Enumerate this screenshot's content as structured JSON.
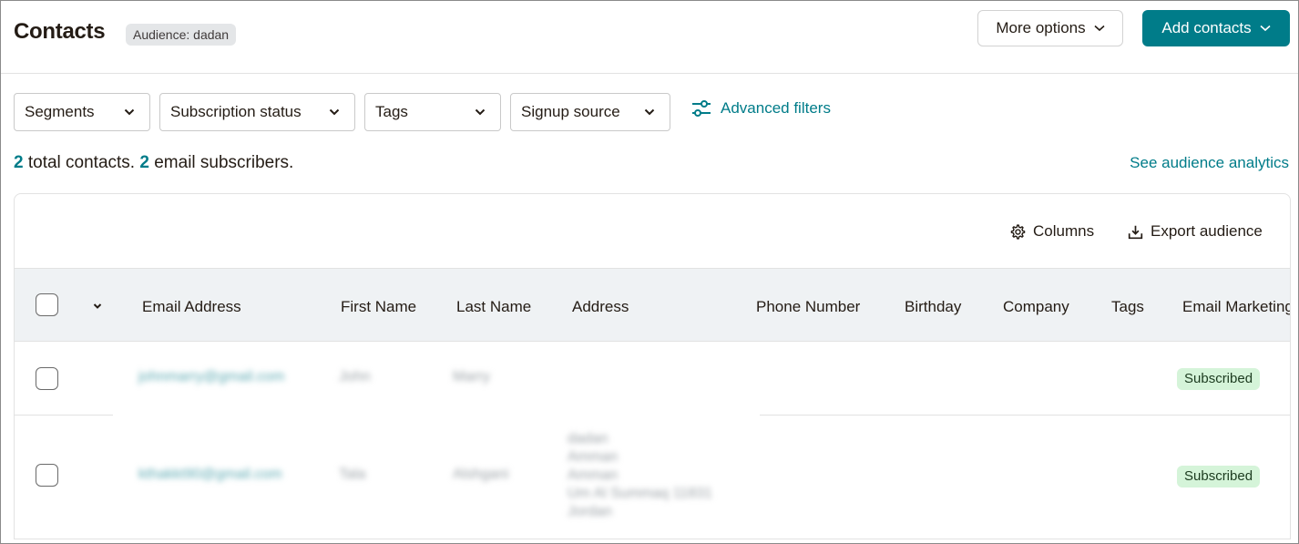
{
  "header": {
    "title": "Contacts",
    "audience_badge": "Audience: dadan",
    "more_options_label": "More options",
    "add_contacts_label": "Add contacts"
  },
  "filters": {
    "segments": "Segments",
    "subscription_status": "Subscription status",
    "tags": "Tags",
    "signup_source": "Signup source",
    "advanced": "Advanced filters"
  },
  "summary": {
    "total_count": "2",
    "total_text": " total contacts. ",
    "email_count": "2",
    "email_text": " email subscribers."
  },
  "analytics_link": "See audience analytics",
  "toolbar": {
    "columns": "Columns",
    "export": "Export audience"
  },
  "table": {
    "columns": [
      "Email Address",
      "First Name",
      "Last Name",
      "Address",
      "Phone Number",
      "Birthday",
      "Company",
      "Tags",
      "Email Marketing"
    ],
    "rows": [
      {
        "email": "johnmarry@gmail.com",
        "first_name": "John",
        "last_name": "Marry",
        "address": [
          "",
          "",
          "",
          "",
          ""
        ],
        "status": "Subscribed"
      },
      {
        "email": "kthakkt90@gmail.com",
        "first_name": "Tala",
        "last_name": "Alshgani",
        "address": [
          "dadan",
          "Amman",
          "Amman",
          "Um Al Summaq 11831",
          "Jordan"
        ],
        "status": "Subscribed"
      }
    ]
  },
  "colors": {
    "accent": "#007c89",
    "header_bg": "#eff2f4",
    "subscribed_bg": "#d5f4d9"
  }
}
